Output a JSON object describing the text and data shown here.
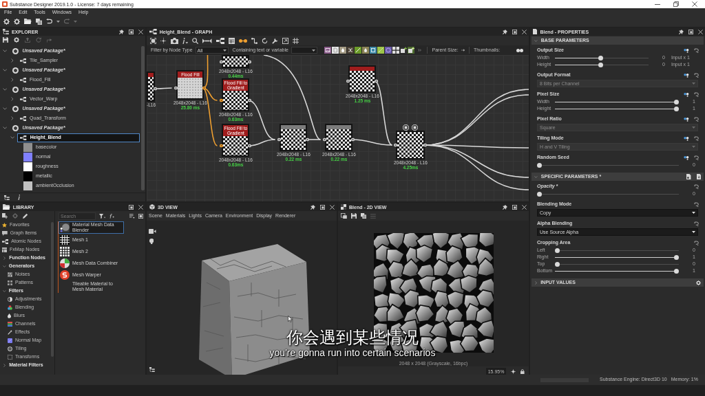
{
  "window": {
    "title": "Substance Designer 2019.1.0 - License: 7 days remaining"
  },
  "menu": [
    "File",
    "Edit",
    "Tools",
    "Windows",
    "Help"
  ],
  "explorer": {
    "title": "EXPLORER",
    "tree": [
      {
        "label": "Unsaved Package*",
        "expanded": true,
        "children": [
          {
            "label": "Tile_Sampler",
            "expanded": false,
            "selected": false
          }
        ]
      },
      {
        "label": "Unsaved Package*",
        "expanded": true,
        "children": [
          {
            "label": "Flood_Fill",
            "expanded": false,
            "selected": false
          }
        ]
      },
      {
        "label": "Unsaved Package*",
        "expanded": true,
        "children": [
          {
            "label": "Vector_Warp",
            "expanded": false,
            "selected": false
          }
        ]
      },
      {
        "label": "Unsaved Package*",
        "expanded": true,
        "children": [
          {
            "label": "Quad_Transform",
            "expanded": false,
            "selected": false
          }
        ]
      },
      {
        "label": "Unsaved Package*",
        "expanded": true,
        "children": [
          {
            "label": "Height_Blend",
            "expanded": true,
            "selected": true,
            "children": [
              {
                "label": "basecolor",
                "color": "#8f8f8f"
              },
              {
                "label": "normal",
                "color": "#8080ff"
              },
              {
                "label": "roughness",
                "color": "#ffffff"
              },
              {
                "label": "metallic",
                "color": "#000000"
              },
              {
                "label": "ambientOcclusion",
                "color": "#c2c2c2"
              }
            ]
          }
        ]
      }
    ]
  },
  "graph": {
    "title": "Height_Blend - GRAPH",
    "filter": {
      "label": "Filter by Node Type",
      "value": "All"
    },
    "search": {
      "label": "Containing text or variable"
    },
    "parent_size_label": "Parent Size:",
    "thumbnails_label": "Thumbnails:",
    "nodes": [
      {
        "color": "#a01d1d",
        "size": "-L16"
      },
      {
        "color": "#a01d1d",
        "header": "Flood Fill",
        "size": "2048x2048 - L16",
        "time": "25.80 ms"
      },
      {
        "size": "2048x2048 - L16",
        "time": "0.44ms"
      },
      {
        "color": "#a01d1d",
        "header": "Flood Fill to Gradient",
        "size": "2048x2048 - L16",
        "time": "0.63ms"
      },
      {
        "color": "#a01d1d",
        "header": "Flood Fill to Gradient",
        "size": "2048x2048 - L16",
        "time": "0.63ms"
      },
      {
        "color": "#7b7b7b",
        "size": "2048x2048 - L16",
        "time": "0.22 ms"
      },
      {
        "color": "#7b7b7b",
        "size": "2048x2048 - L16",
        "time": "0.22 ms"
      },
      {
        "color": "#a01d1d",
        "size": "2048x2048 - L16",
        "time": "1.25 ms"
      },
      {
        "size": "2048x2048 - L16",
        "time": "4.25ms"
      }
    ]
  },
  "library": {
    "title": "LIBRARY",
    "search": {
      "placeholder": "Search"
    },
    "categories": [
      {
        "kind": "item",
        "label": "Favorites"
      },
      {
        "kind": "item",
        "label": "Graph Items"
      },
      {
        "kind": "item",
        "label": "Atomic Nodes"
      },
      {
        "kind": "item",
        "label": "FxMap Nodes"
      },
      {
        "kind": "group",
        "label": "Function Nodes",
        "expanded": false
      },
      {
        "kind": "group",
        "label": "Generators",
        "expanded": true,
        "children": [
          {
            "label": "Noises"
          },
          {
            "label": "Patterns"
          }
        ]
      },
      {
        "kind": "group",
        "label": "Filters",
        "expanded": true,
        "children": [
          {
            "label": "Adjustments"
          },
          {
            "label": "Blending"
          },
          {
            "label": "Blurs"
          },
          {
            "label": "Channels"
          },
          {
            "label": "Effects"
          },
          {
            "label": "Normal Map"
          },
          {
            "label": "Tiling"
          },
          {
            "label": "Transforms"
          }
        ]
      },
      {
        "kind": "group",
        "label": "Material Filters",
        "expanded": false
      }
    ],
    "items": [
      {
        "label": "Material Mesh Data Blender",
        "selected": true
      },
      {
        "label": "Mesh 1",
        "selected": false
      },
      {
        "label": "Mesh 2",
        "selected": false
      },
      {
        "label": "Mesh Data Combiner",
        "selected": false
      },
      {
        "label": "Mesh Warper",
        "selected": false
      },
      {
        "label": "Tileable Material to Mesh Material",
        "selected": false
      }
    ]
  },
  "view3d": {
    "title": "3D VIEW",
    "menu": [
      "Scene",
      "Materials",
      "Lights",
      "Camera",
      "Environment",
      "Display",
      "Renderer"
    ]
  },
  "view2d": {
    "title": "Blend - 2D VIEW",
    "info": "2048 x 2048 (Grayscale, 16bpc)",
    "zoom": "15.95%"
  },
  "properties": {
    "title": "Blend - PROPERTIES",
    "sections": [
      {
        "title": "BASE PARAMETERS",
        "expanded": true,
        "params": [
          {
            "label": "Output Size",
            "kind": "sliders",
            "linkable": true,
            "rows": [
              {
                "label": "Width",
                "level": 0.49,
                "value": "0",
                "suffix": "Input x 1"
              },
              {
                "label": "Height",
                "level": 0.49,
                "value": "0",
                "suffix": "Input x 1"
              }
            ]
          },
          {
            "label": "Output Format",
            "kind": "dropdown",
            "linkable": true,
            "value": "8 Bits per Channel",
            "disabled": true
          },
          {
            "label": "Pixel Size",
            "kind": "sliders",
            "linkable": true,
            "rows": [
              {
                "label": "Width",
                "level": 1,
                "value": "1"
              },
              {
                "label": "Height",
                "level": 1,
                "value": "1"
              }
            ]
          },
          {
            "label": "Pixel Ratio",
            "kind": "dropdown",
            "linkable": true,
            "value": "Square",
            "disabled": true
          },
          {
            "label": "Tiling Mode",
            "kind": "dropdown",
            "linkable": true,
            "value": "H and V Tiling",
            "disabled": true
          },
          {
            "label": "Random Seed",
            "kind": "sliders",
            "linkable": true,
            "rows": [
              {
                "level": 0,
                "value": "0"
              }
            ]
          }
        ]
      },
      {
        "title": "SPECIFIC PARAMETERS *",
        "expanded": true,
        "params": [
          {
            "label": "Opacity *",
            "kind": "sliders",
            "linkable": false,
            "modified": true,
            "rows": [
              {
                "level": 0,
                "value": "0"
              }
            ]
          },
          {
            "label": "Blending Mode",
            "kind": "dropdown",
            "linkable": false,
            "value": "Copy",
            "disabled": false
          },
          {
            "label": "Alpha Blending",
            "kind": "dropdown",
            "linkable": false,
            "value": "Use Source Alpha",
            "disabled": false
          },
          {
            "label": "Cropping Area",
            "kind": "sliders",
            "linkable": false,
            "rows": [
              {
                "label": "Left",
                "level": 0,
                "value": "0"
              },
              {
                "label": "Right",
                "level": 1,
                "value": "1"
              },
              {
                "label": "Top",
                "level": 0,
                "value": "0"
              },
              {
                "label": "Bottom",
                "level": 1,
                "value": "1"
              }
            ]
          }
        ]
      },
      {
        "title": "INPUT VALUES",
        "expanded": false
      }
    ]
  },
  "status_bar": {
    "engine": "Substance Engine: Direct3D 10",
    "memory": "Memory: 1%"
  },
  "subtitles": [
    "你会遇到某些情况",
    "you're gonna run into certain scenarios"
  ]
}
